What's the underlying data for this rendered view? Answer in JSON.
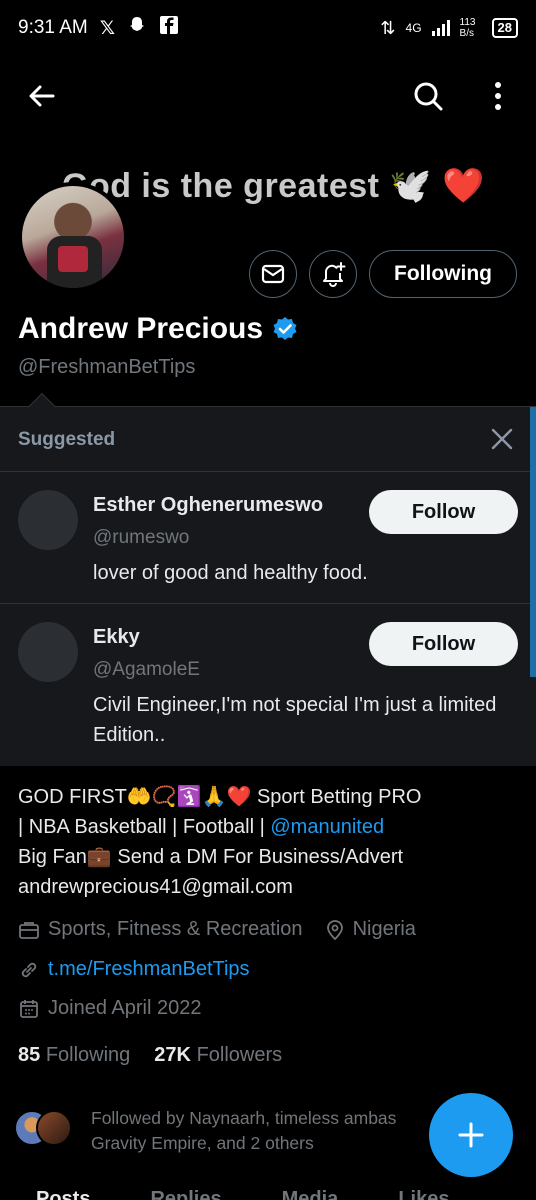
{
  "status_bar": {
    "time": "9:31 AM",
    "network": "4G",
    "speed": "113 B/s",
    "battery": "28"
  },
  "banner": {
    "text": "God is the greatest 🕊️ ❤️"
  },
  "profile": {
    "name": "Andrew Precious",
    "handle": "@FreshmanBetTips",
    "following_button": "Following",
    "verified": true,
    "bio_line1": "GOD FIRST🤲📿🛐🙏❤️ Sport Betting PRO",
    "bio_line2_prefix": "| NBA Basketball | Football | ",
    "bio_mention": "@manunited",
    "bio_line3": "Big Fan💼 Send a DM For Business/Advert",
    "bio_line4": "andrewprecious41@gmail.com",
    "category": "Sports, Fitness & Recreation",
    "location": "Nigeria",
    "link": "t.me/FreshmanBetTips",
    "joined": "Joined April 2022",
    "following_count": "85",
    "following_label": "Following",
    "followers_count": "27K",
    "followers_label": "Followers",
    "followed_by_line1": "Followed by Naynaarh, timeless ambas",
    "followed_by_line2": "Gravity Empire, and 2 others"
  },
  "suggested": {
    "title": "Suggested",
    "items": [
      {
        "name": "Esther Oghenerumeswo",
        "handle": "@rumeswo",
        "bio": "lover of good and healthy food.",
        "button": "Follow"
      },
      {
        "name": "Ekky",
        "handle": "@AgamoleE",
        "bio": "Civil Engineer,I'm not special I'm just a limited Edition..",
        "button": "Follow"
      }
    ]
  },
  "tabs": [
    "Posts",
    "Replies",
    "Media",
    "Likes"
  ],
  "colors": {
    "accent": "#1d9bf0",
    "background": "#000000",
    "card": "#16181c",
    "muted": "#71767b"
  }
}
